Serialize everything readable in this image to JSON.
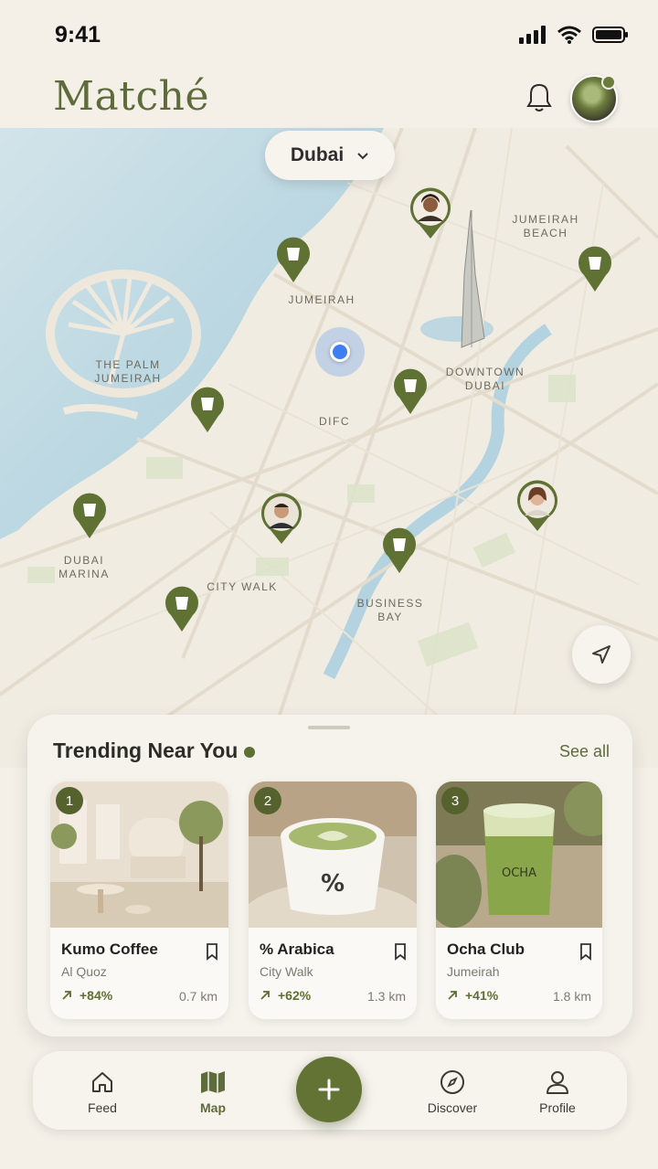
{
  "status": {
    "time": "9:41"
  },
  "header": {
    "brand": "Matché"
  },
  "map": {
    "city": "Dubai",
    "labels": {
      "jumeirah_beach": [
        "JUMEIRAH",
        "BEACH"
      ],
      "jumeirah": "JUMEIRAH",
      "palm": [
        "THE PALM",
        "JUMEIRAH"
      ],
      "downtown": [
        "DOWNTOWN",
        "DUBAI"
      ],
      "difc": "DIFC",
      "marina": [
        "DUBAI",
        "MARINA"
      ],
      "city_walk": "CITY WALK",
      "business_bay": [
        "BUSINESS",
        "BAY"
      ]
    }
  },
  "trending": {
    "title": "Trending Near You",
    "see_all": "See all",
    "cards": [
      {
        "rank": "1",
        "name": "Kumo Coffee",
        "location": "Al Quoz",
        "trend": "+84%",
        "distance": "0.7 km"
      },
      {
        "rank": "2",
        "name": "% Arabica",
        "location": "City Walk",
        "trend": "+62%",
        "distance": "1.3 km"
      },
      {
        "rank": "3",
        "name": "Ocha Club",
        "location": "Jumeirah",
        "trend": "+41%",
        "distance": "1.8 km"
      }
    ]
  },
  "tabs": [
    {
      "label": "Feed",
      "icon": "home-icon"
    },
    {
      "label": "Map",
      "icon": "map-icon"
    },
    {
      "label": "Discover",
      "icon": "compass-icon"
    },
    {
      "label": "Profile",
      "icon": "person-icon"
    }
  ],
  "colors": {
    "accent": "#5e6b3a",
    "background": "#f4f0e8",
    "water": "#a9cfe0",
    "location_dot": "#3d7ff0"
  }
}
